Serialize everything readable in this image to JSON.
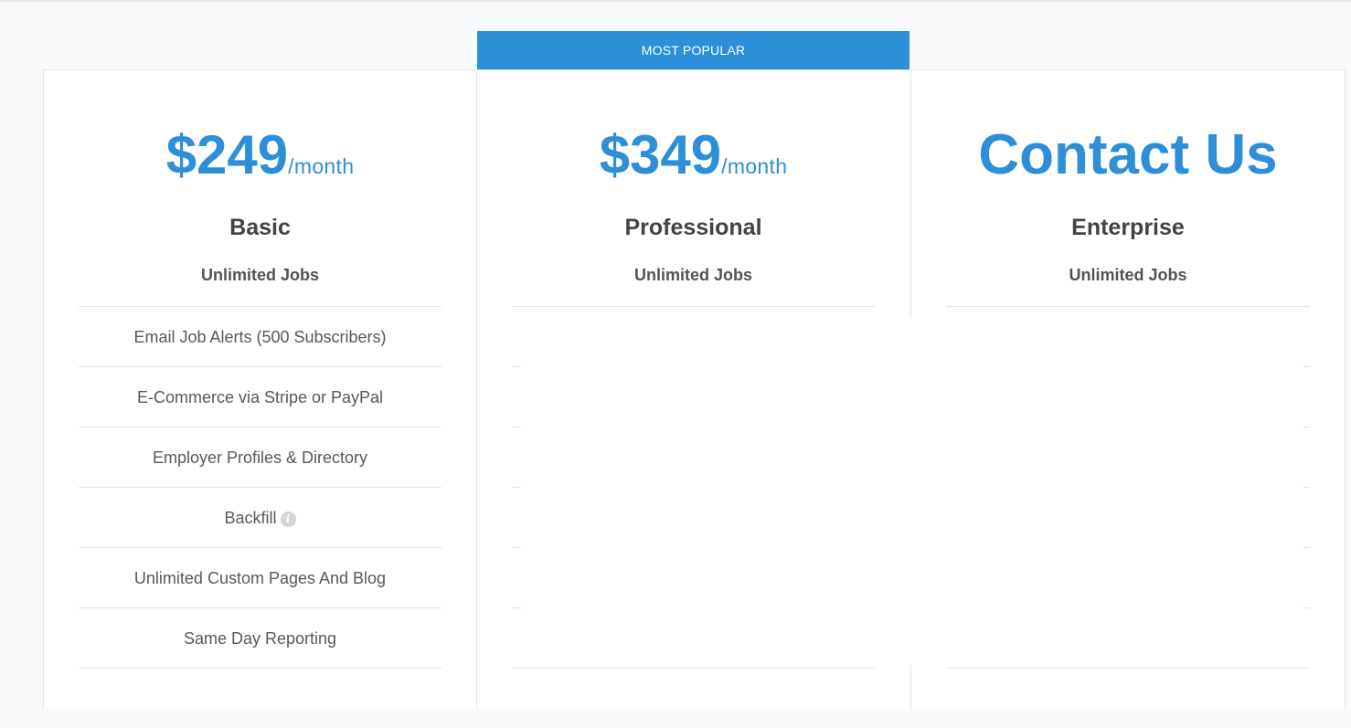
{
  "badge": {
    "label": "MOST POPULAR"
  },
  "plans": [
    {
      "price": "$249",
      "period": "/month",
      "name": "Basic",
      "jobs": "Unlimited Jobs",
      "features": [
        "Email Job Alerts (500 Subscribers)",
        "E-Commerce via Stripe or PayPal",
        "Employer Profiles & Directory",
        "Backfill",
        "Unlimited Custom Pages And Blog",
        "Same Day Reporting"
      ]
    },
    {
      "price": "$349",
      "period": "/month",
      "name": "Professional",
      "jobs": "Unlimited Jobs"
    },
    {
      "price": "Contact Us",
      "name": "Enterprise",
      "jobs": "Unlimited Jobs"
    }
  ],
  "colors": {
    "accent": "#2d8fd8",
    "heading": "#404448",
    "text": "#55595d",
    "divider": "#e1e4e8",
    "page_bg": "#f9fafc"
  },
  "icons": {
    "backfill_info": "info-icon"
  }
}
